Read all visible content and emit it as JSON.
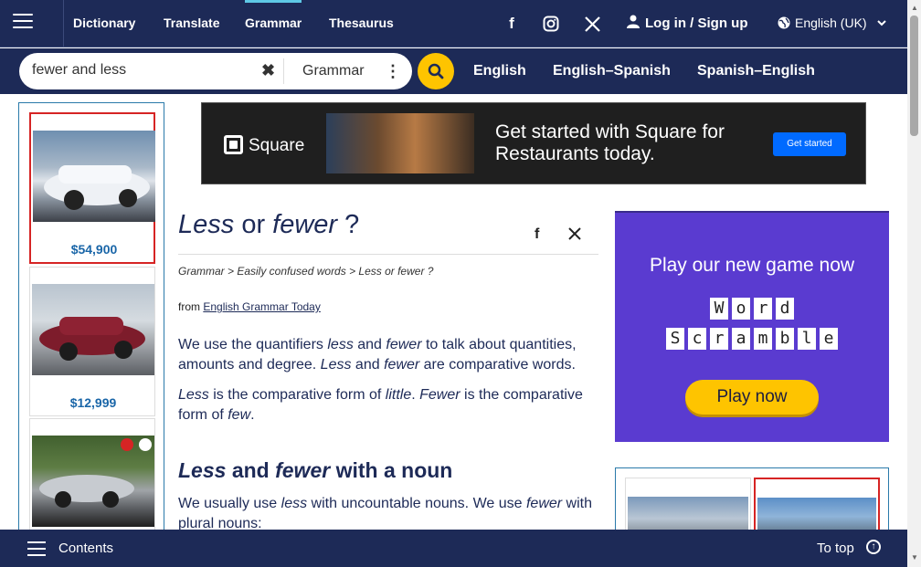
{
  "header": {
    "nav": [
      "Dictionary",
      "Translate",
      "Grammar",
      "Thesaurus"
    ],
    "active_nav": "Grammar",
    "login_label": "Log in / Sign up",
    "language": "English (UK)"
  },
  "search": {
    "value": "fewer and less",
    "dictionary": "Grammar",
    "tabs": [
      "English",
      "English–Spanish",
      "Spanish–English"
    ]
  },
  "left_ad": {
    "prices": [
      "$54,900",
      "$12,999"
    ]
  },
  "banner": {
    "brand": "Square",
    "headline": "Get started with Square for Restaurants today.",
    "cta": "Get started"
  },
  "article": {
    "title_word1": "Less",
    "title_or": " or ",
    "title_word2": "fewer",
    "title_q": " ?",
    "breadcrumb": "Grammar > Easily confused words > Less or fewer ?",
    "from_prefix": "from ",
    "source": "English Grammar Today",
    "p1": {
      "a": "We use the quantifiers ",
      "less": "less",
      "b": " and ",
      "fewer": "fewer",
      "c": " to talk about quantities, amounts and degree. ",
      "less2": "Less",
      "d": " and ",
      "fewer2": "fewer",
      "e": " are comparative words."
    },
    "p2": {
      "less": "Less",
      "a": " is the comparative form of ",
      "little": "little",
      "b": ". ",
      "fewer": "Fewer",
      "c": " is the comparative form of ",
      "few": "few",
      "d": "."
    },
    "h2": {
      "less": "Less",
      "and": " and ",
      "fewer": "fewer",
      "rest": " with a noun"
    },
    "p3": {
      "a": "We usually use ",
      "less": "less",
      "b": " with uncountable nouns. We use ",
      "fewer": "fewer",
      "c": " with plural nouns:"
    }
  },
  "game_ad": {
    "headline": "Play our new game now",
    "word1": [
      "W",
      "o",
      "r",
      "d"
    ],
    "word2": [
      "S",
      "c",
      "r",
      "a",
      "m",
      "b",
      "l",
      "e"
    ],
    "cta": "Play now"
  },
  "footer": {
    "contents": "Contents",
    "to_top": "To top"
  },
  "colors": {
    "navy": "#1d2a57",
    "accent_yellow": "#fec400",
    "active_underline": "#5ec8e5",
    "game_purple": "#5a3bd0"
  }
}
